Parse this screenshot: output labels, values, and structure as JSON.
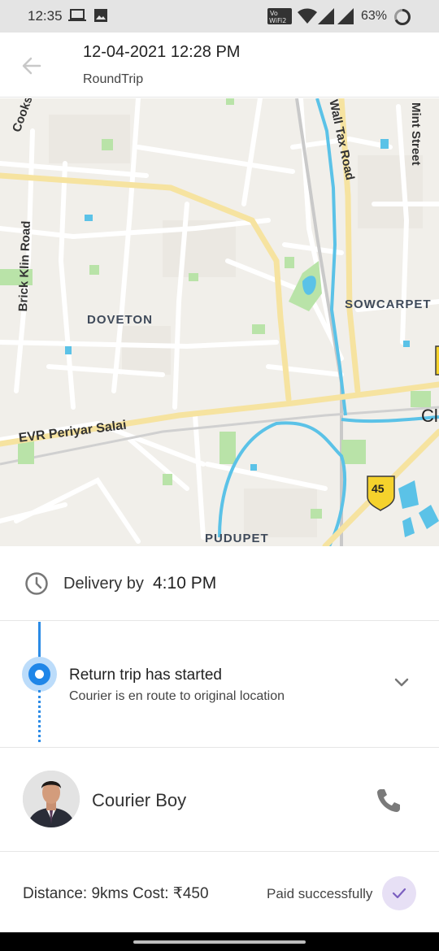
{
  "status_bar": {
    "time": "12:35",
    "battery": "63%",
    "icons": [
      "laptop-icon",
      "image-icon",
      "volte-wifi-icon",
      "wifi-icon",
      "signal-icon",
      "signal-icon",
      "battery-icon"
    ]
  },
  "header": {
    "title": "12-04-2021 12:28 PM",
    "subtitle": "RoundTrip",
    "back_icon": "arrow-left-icon"
  },
  "map": {
    "labels": {
      "doveton": "DOVETON",
      "sowcarpet": "SOWCARPET",
      "pudupet": "PUDUPET",
      "cooks_road": "Cooks Roa",
      "brick_klin_road": "Brick Klin Road",
      "wall_tax_road": "Wall Tax Road",
      "mint_street": "Mint Street",
      "evr_periyar_salai": "EVR Periyar Salai",
      "highway_shield": "45",
      "edge_label": "Cl"
    },
    "colors": {
      "background": "#f1efea",
      "major_road": "#f6e3a0",
      "water": "#5bc2e7",
      "park": "#b9e3a8"
    }
  },
  "delivery": {
    "label": "Delivery by",
    "time": "4:10 PM"
  },
  "trip": {
    "title": "Return trip has started",
    "description": "Courier is en route to original location"
  },
  "courier": {
    "name": "Courier Boy"
  },
  "payment": {
    "info": "Distance: 9kms Cost: ₹450",
    "status": "Paid successfully"
  },
  "colors": {
    "accent_blue": "#1f86e8",
    "check_bg": "#e7e0f5",
    "check_color": "#7b5fc0"
  }
}
